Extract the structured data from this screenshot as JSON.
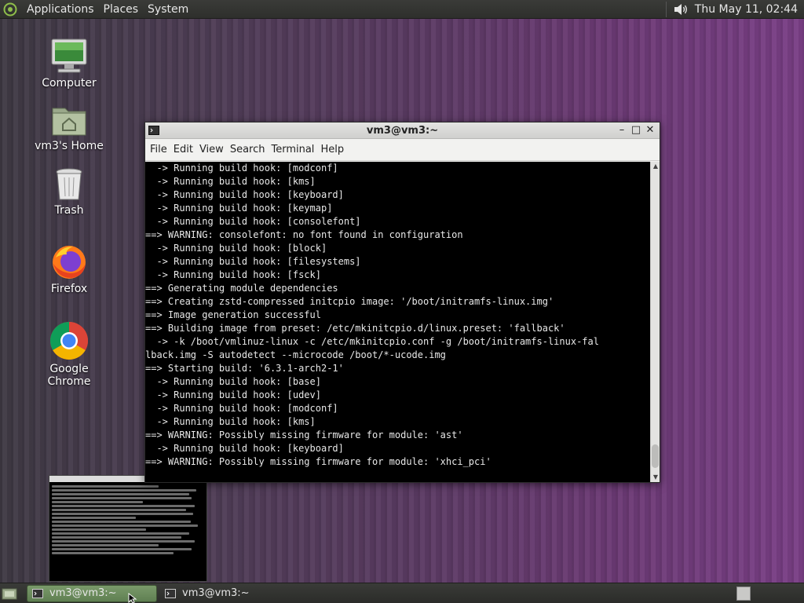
{
  "top_panel": {
    "menus": [
      "Applications",
      "Places",
      "System"
    ],
    "clock": "Thu May 11, 02:44"
  },
  "desktop_icons": [
    {
      "label": "Computer",
      "icon": "computer-icon"
    },
    {
      "label": "vm3's Home",
      "icon": "home-folder-icon"
    },
    {
      "label": "Trash",
      "icon": "trash-icon"
    },
    {
      "label": "Firefox",
      "icon": "firefox-icon"
    },
    {
      "label": "Google Chrome",
      "icon": "chrome-icon"
    }
  ],
  "terminal": {
    "title": "vm3@vm3:~",
    "menu": [
      "File",
      "Edit",
      "View",
      "Search",
      "Terminal",
      "Help"
    ],
    "lines": [
      "  -> Running build hook: [modconf]",
      "  -> Running build hook: [kms]",
      "  -> Running build hook: [keyboard]",
      "  -> Running build hook: [keymap]",
      "  -> Running build hook: [consolefont]",
      "==> WARNING: consolefont: no font found in configuration",
      "  -> Running build hook: [block]",
      "  -> Running build hook: [filesystems]",
      "  -> Running build hook: [fsck]",
      "==> Generating module dependencies",
      "==> Creating zstd-compressed initcpio image: '/boot/initramfs-linux.img'",
      "==> Image generation successful",
      "==> Building image from preset: /etc/mkinitcpio.d/linux.preset: 'fallback'",
      "  -> -k /boot/vmlinuz-linux -c /etc/mkinitcpio.conf -g /boot/initramfs-linux-fal",
      "lback.img -S autodetect --microcode /boot/*-ucode.img",
      "==> Starting build: '6.3.1-arch2-1'",
      "  -> Running build hook: [base]",
      "  -> Running build hook: [udev]",
      "  -> Running build hook: [modconf]",
      "  -> Running build hook: [kms]",
      "==> WARNING: Possibly missing firmware for module: 'ast'",
      "  -> Running build hook: [keyboard]",
      "==> WARNING: Possibly missing firmware for module: 'xhci_pci'"
    ]
  },
  "taskbar": {
    "tasks": [
      {
        "label": "vm3@vm3:~",
        "active": true
      },
      {
        "label": "vm3@vm3:~",
        "active": false
      }
    ]
  },
  "colors": {
    "panel": "#2e2f2c",
    "active_task": "#6a8a5c",
    "terminal_bg": "#000000",
    "terminal_fg": "#e8e8e8"
  }
}
